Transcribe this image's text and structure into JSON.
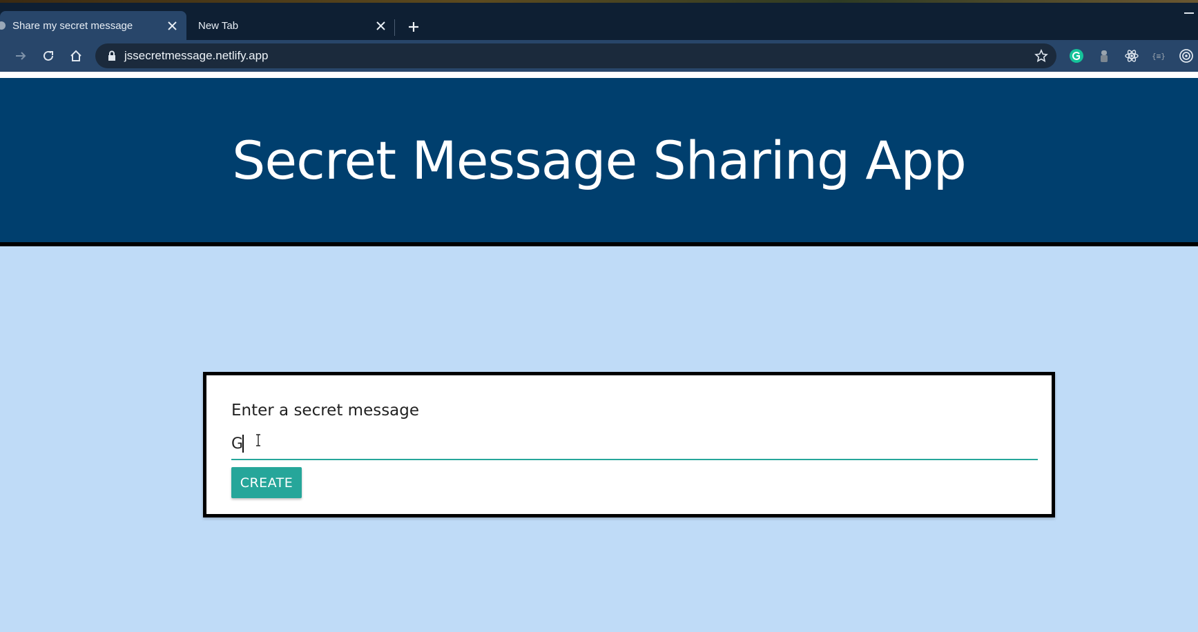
{
  "browser": {
    "tabs": [
      {
        "title": "Share my secret message",
        "active": true
      },
      {
        "title": "New Tab",
        "active": false
      }
    ],
    "address": "jssecretmessage.netlify.app",
    "colors": {
      "tabbar": "#0e1f33",
      "toolbar": "#28466a",
      "omnibox": "#1b2a3c"
    }
  },
  "page": {
    "title": "Secret Message Sharing App",
    "form": {
      "label": "Enter a secret message",
      "value": "G",
      "button_label": "CREATE"
    },
    "colors": {
      "header": "#003f6e",
      "background": "#bfdbf7",
      "accent": "#26a69a"
    }
  }
}
